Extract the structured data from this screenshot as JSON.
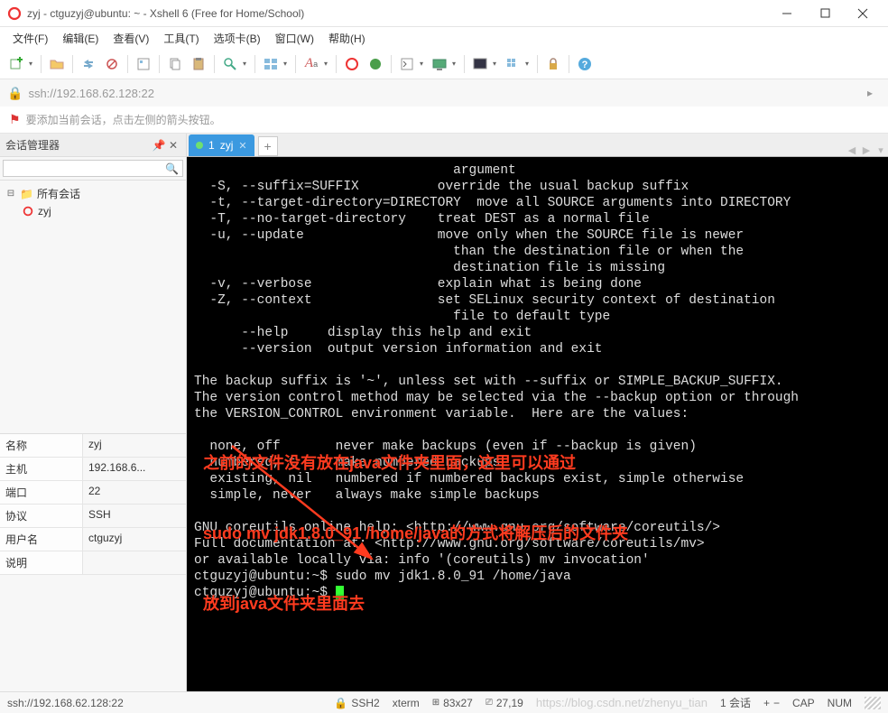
{
  "window": {
    "title": "zyj - ctguzyj@ubuntu: ~ - Xshell 6 (Free for Home/School)"
  },
  "menu": {
    "file": "文件(F)",
    "edit": "编辑(E)",
    "view": "查看(V)",
    "tools": "工具(T)",
    "tabs": "选项卡(B)",
    "window": "窗口(W)",
    "help": "帮助(H)"
  },
  "address": {
    "url": "ssh://192.168.62.128:22"
  },
  "hint": {
    "text": "要添加当前会话，点击左侧的箭头按钮。"
  },
  "sidebar": {
    "title": "会话管理器",
    "search_placeholder": "",
    "root": "所有会话",
    "items": [
      {
        "label": "zyj"
      }
    ]
  },
  "props": {
    "name_label": "名称",
    "name": "zyj",
    "host_label": "主机",
    "host": "192.168.6...",
    "port_label": "端口",
    "port": "22",
    "proto_label": "协议",
    "proto": "SSH",
    "user_label": "用户名",
    "user": "ctguzyj",
    "desc_label": "说明",
    "desc": ""
  },
  "tab": {
    "index": "1",
    "label": "zyj"
  },
  "terminal": {
    "content": "                                 argument\n  -S, --suffix=SUFFIX          override the usual backup suffix\n  -t, --target-directory=DIRECTORY  move all SOURCE arguments into DIRECTORY\n  -T, --no-target-directory    treat DEST as a normal file\n  -u, --update                 move only when the SOURCE file is newer\n                                 than the destination file or when the\n                                 destination file is missing\n  -v, --verbose                explain what is being done\n  -Z, --context                set SELinux security context of destination\n                                 file to default type\n      --help     display this help and exit\n      --version  output version information and exit\n\nThe backup suffix is '~', unless set with --suffix or SIMPLE_BACKUP_SUFFIX.\nThe version control method may be selected via the --backup option or through\nthe VERSION_CONTROL environment variable.  Here are the values:\n\n  none, off       never make backups (even if --backup is given)\n  numbered, t     make numbered backups\n  existing, nil   numbered if numbered backups exist, simple otherwise\n  simple, never   always make simple backups\n\nGNU coreutils online help: <http://www.gnu.org/software/coreutils/>\nFull documentation at: <http://www.gnu.org/software/coreutils/mv>\nor available locally via: info '(coreutils) mv invocation'\nctguzyj@ubuntu:~$ sudo mv jdk1.8.0_91 /home/java\nctguzyj@ubuntu:~$ "
  },
  "annotation": {
    "line1": "之前的文件没有放在java文件夹里面，这里可以通过",
    "line2": "sudo mv jdk1.8.0_91 /home/java的方式将解压后的文件夹",
    "line3": "放到java文件夹里面去"
  },
  "status": {
    "conn": "ssh://192.168.62.128:22",
    "ssh": "SSH2",
    "term": "xterm",
    "size": "83x27",
    "pos": "27,19",
    "sess_label": "1 会话",
    "cap": "CAP",
    "num": "NUM",
    "watermark": "https://blog.csdn.net/zhenyu_tian"
  }
}
